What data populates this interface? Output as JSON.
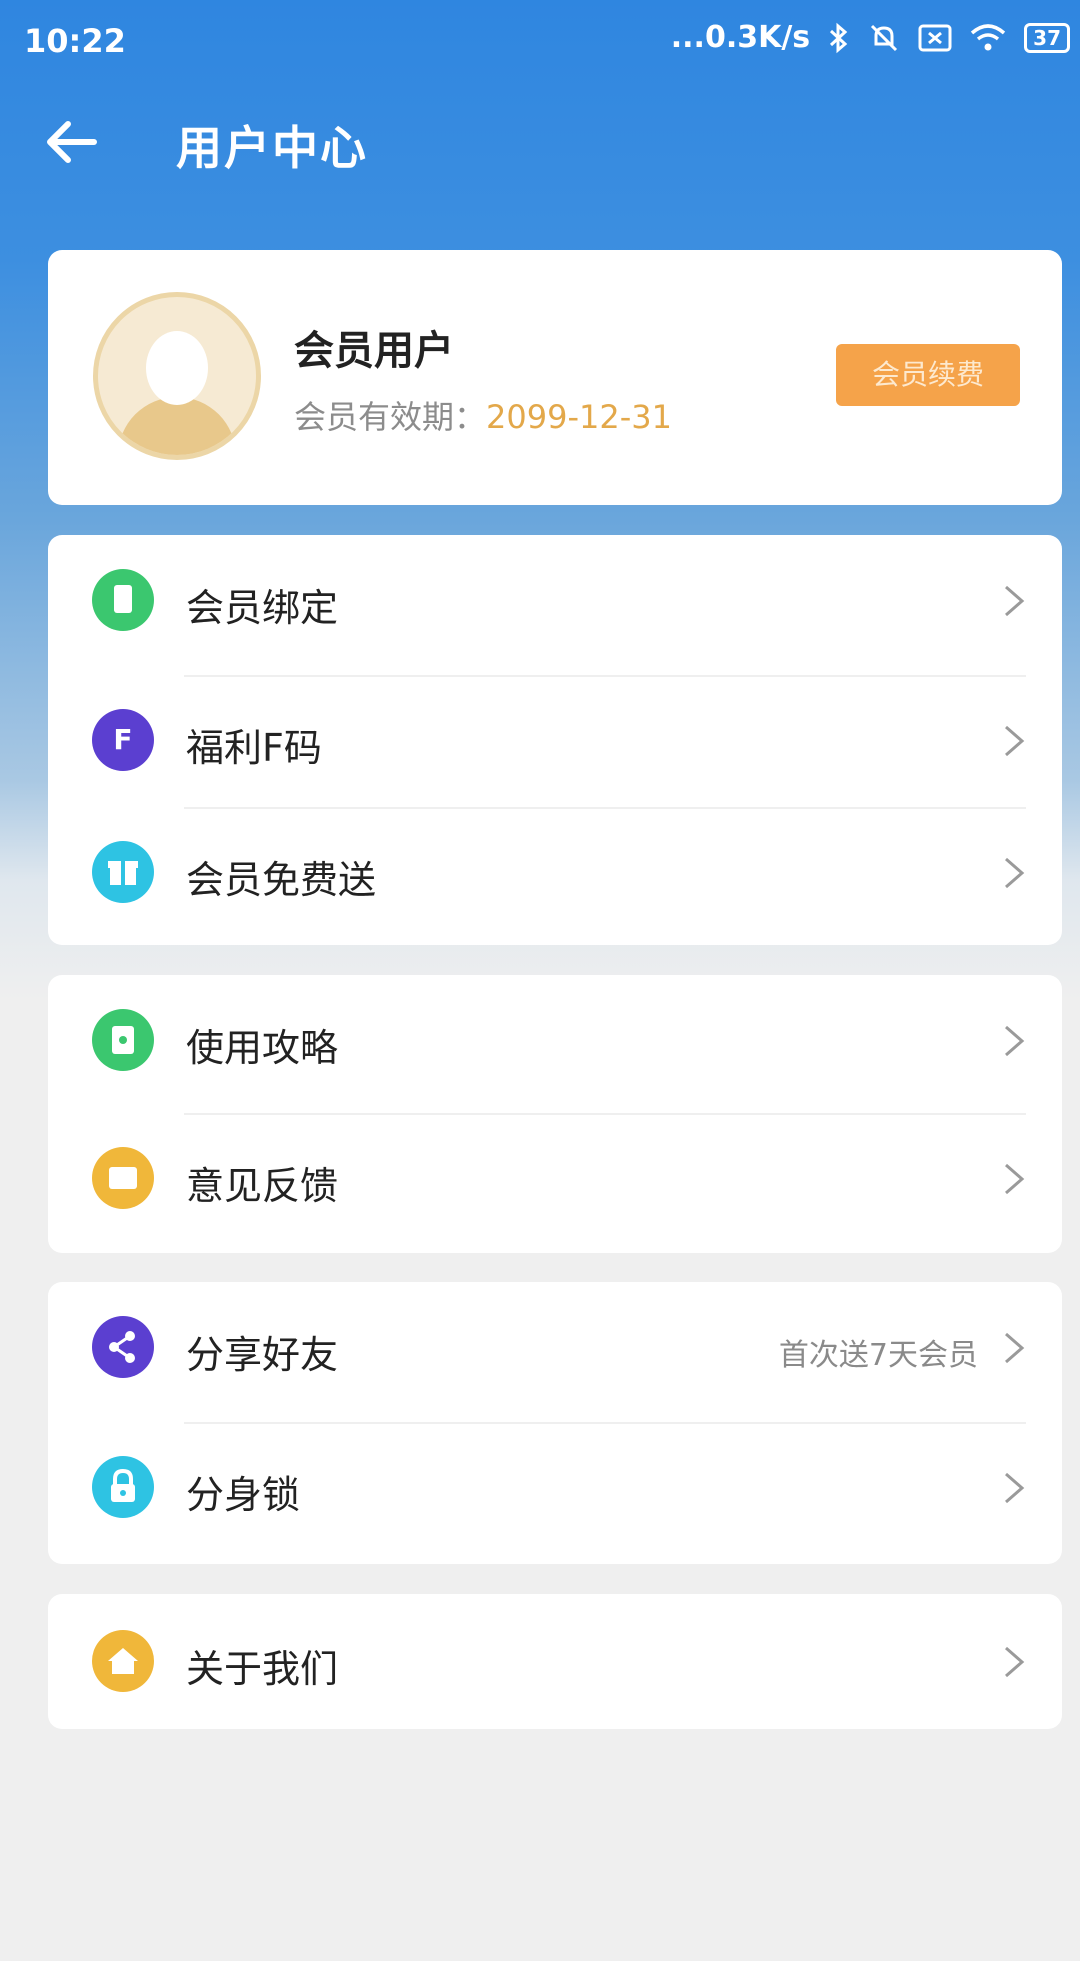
{
  "status": {
    "time": "10:22",
    "network": "...0.3K/s",
    "battery": "37"
  },
  "header": {
    "title": "用户中心"
  },
  "profile": {
    "name": "会员用户",
    "expiry_label": "会员有效期：",
    "expiry_date": "2099-12-31",
    "renew_button": "会员续费"
  },
  "menu": {
    "bind": {
      "label": "会员绑定",
      "icon": "phone-icon",
      "color": "#3bc76f"
    },
    "fcode": {
      "label": "福利F码",
      "icon_text": "F",
      "color": "#5b3fd0"
    },
    "gift": {
      "label": "会员免费送",
      "icon": "gift-icon",
      "color": "#2ec3e3"
    },
    "guide": {
      "label": "使用攻略",
      "icon": "book-icon",
      "color": "#3bc76f"
    },
    "feedback": {
      "label": "意见反馈",
      "icon": "message-icon",
      "color": "#f0b73a"
    },
    "share": {
      "label": "分享好友",
      "hint": "首次送7天会员",
      "icon": "share-icon",
      "color": "#5b3fd0"
    },
    "lock": {
      "label": "分身锁",
      "icon": "lock-icon",
      "color": "#2ec3e3"
    },
    "about": {
      "label": "关于我们",
      "icon": "home-icon",
      "color": "#f0b73a"
    }
  }
}
